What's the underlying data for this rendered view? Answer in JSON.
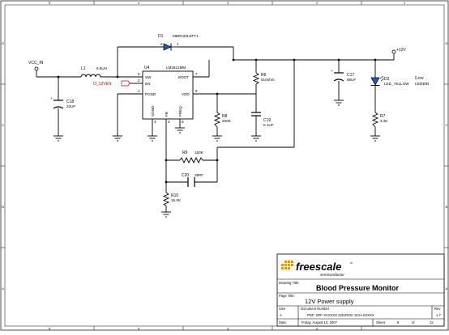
{
  "border": {
    "rows": [
      "D",
      "C",
      "B",
      "A"
    ],
    "cols": [
      "5",
      "4",
      "3",
      "2",
      "1"
    ]
  },
  "nets": {
    "vcc_in": "VCC_IN",
    "out_12v": "+12V",
    "enable": "O_12VEN"
  },
  "components": {
    "d1": {
      "ref": "D1",
      "value": "MBR120LSFT1"
    },
    "l1": {
      "ref": "L1",
      "value": "6.8UH"
    },
    "u4": {
      "ref": "U4",
      "value": "LM2621MM",
      "pins": {
        "sw": "SW",
        "en": "EN",
        "pgnd": "PGND",
        "boot": "BOOT",
        "vdd": "VDD",
        "sgnd": "SGND",
        "fb": "FB",
        "freq": "FREQ",
        "n1": "1",
        "n2": "2",
        "n3": "3",
        "n4": "4",
        "n5": "5",
        "n6": "6",
        "n7": "7",
        "n8": "8"
      }
    },
    "c18": {
      "ref": "C18",
      "value": "22UF"
    },
    "r6": {
      "ref": "R6",
      "value": "510ohm"
    },
    "c19": {
      "ref": "C19",
      "value": "0.1UF"
    },
    "r8": {
      "ref": "R8",
      "value": "200K"
    },
    "c17": {
      "ref": "C17",
      "value": "68UF"
    },
    "d2": {
      "ref": "D2",
      "value": "LED_YELLOW"
    },
    "r7": {
      "ref": "R7",
      "value": "3.3K"
    },
    "r9": {
      "ref": "R9",
      "value": "150K"
    },
    "c20": {
      "ref": "C20",
      "value": "39PF"
    },
    "r10": {
      "ref": "R10",
      "value": "16.0K"
    }
  },
  "annotation": {
    "line1": "Low",
    "line2": "current"
  },
  "title_block": {
    "logo_text": "freescale",
    "logo_tm": "™",
    "logo_sub": "semiconductor",
    "drawing_title_label": "Drawing Title:",
    "drawing_title": "Blood Pressure Monitor",
    "page_title_label": "Page Title:",
    "page_title": "12V Power supply",
    "size_label": "Size",
    "size_value": "A",
    "docnum_label": "Document Number",
    "docnum_value": "PDF: SPF-XXXXXX  SOURCE: SCH-XXXXX",
    "rev_label": "Rev",
    "rev_value": "1.7",
    "date_label": "Date:",
    "date_value": "Friday, August 10, 2007",
    "sheet_label": "Sheet",
    "sheet_value": "8",
    "of_label": "of",
    "of_value": "12"
  },
  "colors": {
    "wire": "#000000",
    "enable_net": "#cc0000",
    "logo_accent": "#f39200"
  }
}
